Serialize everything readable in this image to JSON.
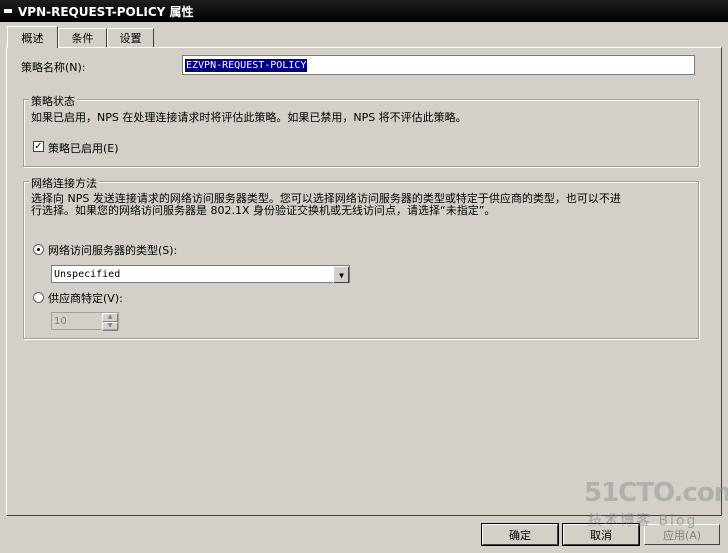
{
  "window": {
    "title": "VPN-REQUEST-POLICY 属性"
  },
  "tabs": [
    {
      "label": "概述",
      "active": true
    },
    {
      "label": "条件",
      "active": false
    },
    {
      "label": "设置",
      "active": false
    }
  ],
  "policy_name": {
    "label": "策略名称(N):",
    "value": "EZVPN-REQUEST-POLICY"
  },
  "policy_state": {
    "title": "策略状态",
    "description": "如果已启用，NPS 在处理连接请求时将评估此策略。如果已禁用，NPS 将不评估此策略。",
    "enabled_checkbox": {
      "label": "策略已启用(E)",
      "checked": true
    }
  },
  "network_connection": {
    "title": "网络连接方法",
    "description_line1": "选择向 NPS 发送连接请求的网络访问服务器类型。您可以选择网络访问服务器的类型或特定于供应商的类型，也可以不进",
    "description_line2": "行选择。如果您的网络访问服务器是 802.1X 身份验证交换机或无线访问点，请选择“未指定”。",
    "server_type_radio": {
      "label": "网络访问服务器的类型(S):",
      "selected": true
    },
    "server_type_value": "Unspecified",
    "vendor_radio": {
      "label": "供应商特定(V):",
      "selected": false
    },
    "vendor_value": "10"
  },
  "buttons": {
    "ok": "确定",
    "cancel": "取消",
    "apply": "应用(A)"
  },
  "watermark": {
    "brand": "51CTO.com",
    "sub": "技术博客 Blog"
  }
}
